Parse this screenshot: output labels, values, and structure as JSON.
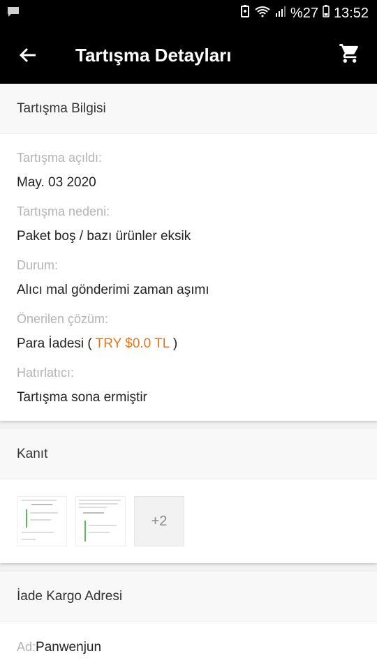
{
  "status_bar": {
    "battery_percent": "%27",
    "time": "13:52"
  },
  "app_bar": {
    "title": "Tartışma Detayları"
  },
  "dispute_info": {
    "header": "Tartışma Bilgisi",
    "fields": [
      {
        "label": "Tartışma açıldı:",
        "value": "May. 03 2020"
      },
      {
        "label": "Tartışma nedeni:",
        "value": "Paket boş / bazı ürünler eksik"
      },
      {
        "label": "Durum:",
        "value": "Alıcı mal gönderimi zaman aşımı"
      },
      {
        "label": "Önerilen çözüm:",
        "value_prefix": "Para İadesi ( ",
        "amount": "TRY $0.0 TL",
        "value_suffix": " )"
      },
      {
        "label": "Hatırlatıcı:",
        "value": "Tartışma sona ermiştir"
      }
    ]
  },
  "evidence": {
    "header": "Kanıt",
    "more_count": "+2"
  },
  "return_address": {
    "header": "İade Kargo Adresi",
    "name_label": "Ad:",
    "name_value": "Panwenjun"
  },
  "colors": {
    "accent": "#e8741a",
    "bar": "#000000"
  }
}
